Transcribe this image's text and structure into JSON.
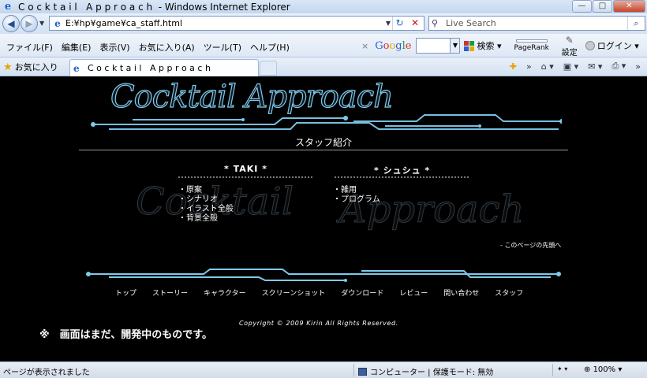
{
  "window": {
    "title": "C o c k t a i l   A p p r o a c h  - Windows Internet Explorer",
    "minimize": "—",
    "maximize": "□",
    "close": "✕"
  },
  "address": {
    "url": "E:¥hp¥game¥ca_staff.html",
    "search_placeholder": "Live Search"
  },
  "menu": [
    "ファイル(F)",
    "編集(E)",
    "表示(V)",
    "お気に入り(A)",
    "ツール(T)",
    "ヘルプ(H)"
  ],
  "google_toolbar": {
    "close": "×",
    "logo": "Google",
    "search_label": "検索",
    "pagerank_label": "PageRank",
    "settings_label": "設定",
    "login_label": "ログイン"
  },
  "tabs": {
    "favorites_label": "お気に入り",
    "active_tab": "C o c k t a i l   A p p r o a c h"
  },
  "page": {
    "logo_text": "Cocktail Approach",
    "section_title": "スタッフ紹介",
    "watermark_left": "Cocktail",
    "watermark_right": "Approach",
    "staff": [
      {
        "name": "* TAKI *",
        "roles": [
          "・原案",
          "・シナリオ",
          "・イラスト全般",
          "・背景全般"
        ]
      },
      {
        "name": "* シュシュ *",
        "roles": [
          "・雑用",
          "・プログラム"
        ]
      }
    ],
    "page_top_link": "- このページの先頭へ",
    "footer_nav": [
      "トップ",
      "ストーリー",
      "キャラクター",
      "スクリーンショット",
      "ダウンロード",
      "レビュー",
      "問い合わせ",
      "スタッフ"
    ],
    "copyright": "Copyright © 2009 Kirin All Rights Reserved.",
    "notice": "※　画面はまだ、開発中のものです。"
  },
  "status": {
    "message": "ページが表示されました",
    "zone": "コンピューター | 保護モード: 無効",
    "zoom": "100%"
  },
  "colors": {
    "accent_glow": "#7fc9ea",
    "background": "#000000"
  }
}
